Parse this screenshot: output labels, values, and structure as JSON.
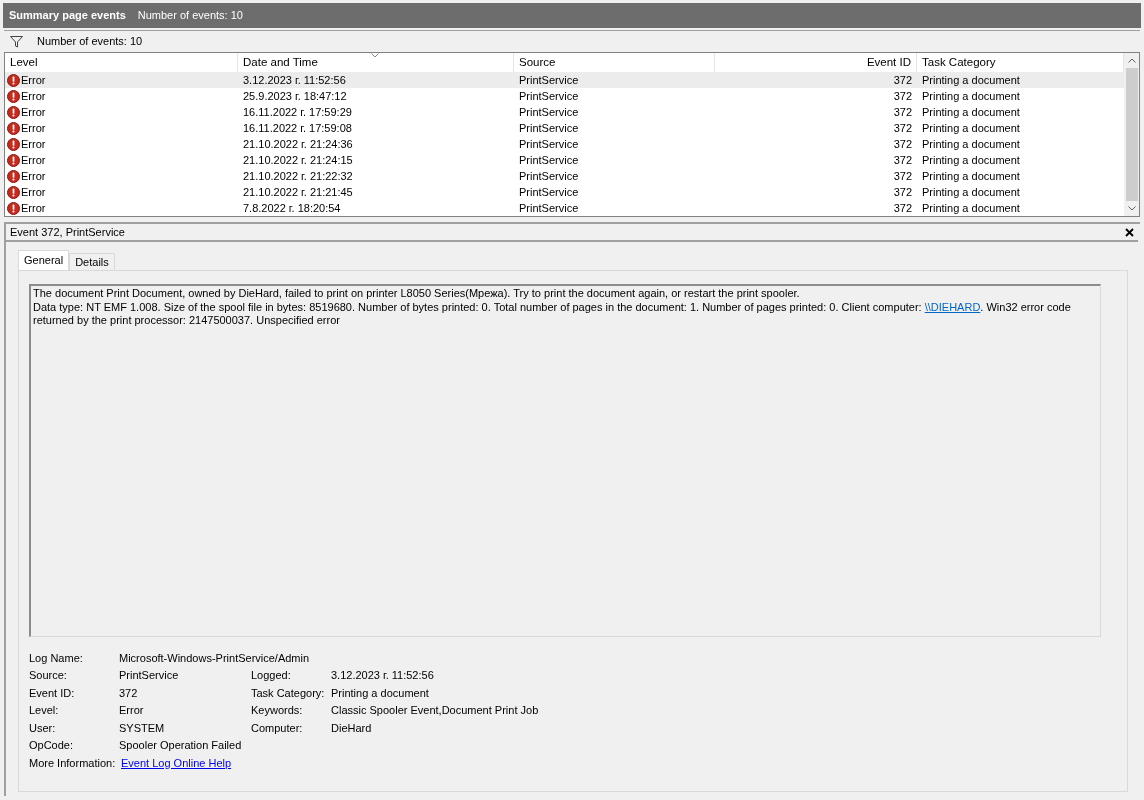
{
  "header": {
    "title": "Summary page events",
    "count": "Number of events: 10"
  },
  "filter_bar": {
    "text": "Number of events: 10"
  },
  "table": {
    "columns": [
      "Level",
      "Date and Time",
      "Source",
      "Event ID",
      "Task Category"
    ],
    "rows": [
      {
        "level": "Error",
        "date": "3.12.2023 г. 11:52:56",
        "source": "PrintService",
        "event_id": "372",
        "category": "Printing a document",
        "selected": true
      },
      {
        "level": "Error",
        "date": "25.9.2023 г. 18:47:12",
        "source": "PrintService",
        "event_id": "372",
        "category": "Printing a document",
        "selected": false
      },
      {
        "level": "Error",
        "date": "16.11.2022 г. 17:59:29",
        "source": "PrintService",
        "event_id": "372",
        "category": "Printing a document",
        "selected": false
      },
      {
        "level": "Error",
        "date": "16.11.2022 г. 17:59:08",
        "source": "PrintService",
        "event_id": "372",
        "category": "Printing a document",
        "selected": false
      },
      {
        "level": "Error",
        "date": "21.10.2022 г. 21:24:36",
        "source": "PrintService",
        "event_id": "372",
        "category": "Printing a document",
        "selected": false
      },
      {
        "level": "Error",
        "date": "21.10.2022 г. 21:24:15",
        "source": "PrintService",
        "event_id": "372",
        "category": "Printing a document",
        "selected": false
      },
      {
        "level": "Error",
        "date": "21.10.2022 г. 21:22:32",
        "source": "PrintService",
        "event_id": "372",
        "category": "Printing a document",
        "selected": false
      },
      {
        "level": "Error",
        "date": "21.10.2022 г. 21:21:45",
        "source": "PrintService",
        "event_id": "372",
        "category": "Printing a document",
        "selected": false
      },
      {
        "level": "Error",
        "date": "7.8.2022 г. 18:20:54",
        "source": "PrintService",
        "event_id": "372",
        "category": "Printing a document",
        "selected": false
      }
    ]
  },
  "detail": {
    "title": "Event 372, PrintService",
    "tabs": [
      {
        "label": "General",
        "selected": true
      },
      {
        "label": "Details",
        "selected": false
      }
    ],
    "message": {
      "line1": "The document Print Document, owned by DieHard, failed to print on printer L8050 Series(Мрежа). Try to print the document again, or restart the print spooler.",
      "before": "Data type: NT EMF 1.008. Size of the spool file in bytes: 8519680. Number of bytes printed: 0. Total number of pages in the document: 1. Number of pages printed: 0. Client computer: ",
      "link": "\\\\DIEHARD",
      "after": ". Win32 error code returned by the print processor: 2147500037. Unspecified error"
    },
    "fields": [
      [
        {
          "label": "Log Name:",
          "value": "Microsoft-Windows-PrintService/Admin"
        }
      ],
      [
        {
          "label": "Source:",
          "value": "PrintService"
        },
        {
          "label": "Logged:",
          "value": "3.12.2023 г. 11:52:56"
        }
      ],
      [
        {
          "label": "Event ID:",
          "value": "372"
        },
        {
          "label": "Task Category:",
          "value": "Printing a document"
        }
      ],
      [
        {
          "label": "Level:",
          "value": "Error"
        },
        {
          "label": "Keywords:",
          "value": "Classic Spooler Event,Document Print Job"
        }
      ],
      [
        {
          "label": "User:",
          "value": "SYSTEM"
        },
        {
          "label": "Computer:",
          "value": "DieHard"
        }
      ],
      [
        {
          "label": "OpCode:",
          "value": "Spooler Operation Failed"
        }
      ]
    ],
    "more_info": {
      "label": "More Information:",
      "link": "Event Log Online Help"
    }
  }
}
